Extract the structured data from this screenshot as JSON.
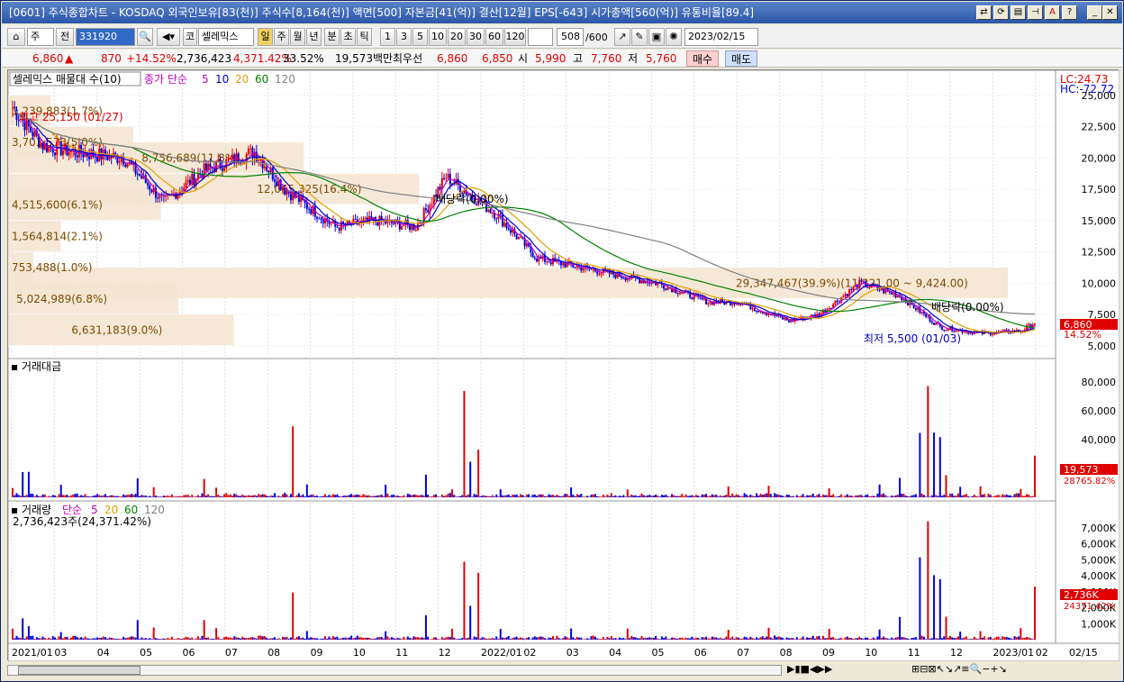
{
  "window": {
    "title": "[0601] 주식종합차트 - KOSDAQ 외국인보유[83(천)] 주식수[8,164(천)] 액면[500] 자본금[41(억)] 결산[12월] EPS[-643] 시가총액[560(억)] 유통비율[89.4]"
  },
  "toolbar": {
    "market": "주",
    "prev_label": "전",
    "code": "331920",
    "code_market": "코",
    "stock_name": "셀레믹스",
    "periods": [
      "일",
      "주",
      "월",
      "년",
      "분",
      "초",
      "틱"
    ],
    "active_period": "일",
    "intervals": [
      "1",
      "3",
      "5",
      "10",
      "20",
      "30",
      "60",
      "120"
    ],
    "count": "508",
    "count_max": "/600",
    "date": "2023/02/15"
  },
  "quote": {
    "price": "6,860",
    "change": "870",
    "change_pct": "+14.52%",
    "volume": "2,736,423",
    "vol_pct": "4,371.42%",
    "turnover": "33.52%",
    "amount": "19,573백만",
    "pref_label": "최우선",
    "ask": "6,860",
    "bid": "6,850",
    "open_label": "시",
    "open": "5,990",
    "high_label": "고",
    "high": "7,760",
    "low_label": "저",
    "low": "5,760",
    "buy_label": "매수",
    "sell_label": "매도"
  },
  "price_pane": {
    "legend_title": "셀레믹스 매물대 수(10)",
    "ma_label": "종가 단순",
    "ma": [
      "5",
      "10",
      "20",
      "60",
      "120"
    ],
    "lc": "LC:24.73",
    "hc": "HC:-72.72",
    "ticks": [
      "25,000",
      "22,500",
      "20,000",
      "17,500",
      "15,000",
      "12,500",
      "10,000",
      "7,500",
      "5,000"
    ],
    "last_price_tag": "6,860",
    "last_pct": "14.52%",
    "high_note": "최고 25,150 (01/27)",
    "low_note": "최저 5,500 (01/03)",
    "dividend_1": "배당락(0.00%)",
    "dividend_2": "배당락(0.00%)",
    "profile": [
      {
        "label": "1,239,883(1.7%)",
        "level": 23750
      },
      {
        "label": "3,703,573(5.0%)",
        "level": 21250
      },
      {
        "label": "4,515,600(6.1%)",
        "level": 16250
      },
      {
        "label": "1,564,814(2.1%)",
        "level": 13750
      },
      {
        "label": "753,488(1.0%)",
        "level": 11250
      },
      {
        "label": "5,024,989(6.8%)",
        "level": 8750
      },
      {
        "label": "6,631,183(9.0%)",
        "level": 6250
      },
      {
        "label": "8,756,689(11.8%)",
        "level": 20000
      },
      {
        "label": "12,065,325(16.4%)",
        "level": 17500
      },
      {
        "label": "29,347,467(39.9%)(11,321.00 ~ 9,424.00)",
        "level": 10000
      }
    ]
  },
  "amount_pane": {
    "title": "거래대금",
    "ticks": [
      "80,000",
      "60,000",
      "40,000",
      "20,000"
    ],
    "last_tag": "19,573",
    "avg_tag": "28765.82%"
  },
  "volume_pane": {
    "title": "거래량",
    "ma_label": "단순",
    "ma": [
      "5",
      "20",
      "60",
      "120"
    ],
    "last_info": "2,736,423주(24,371.42%)",
    "ticks": [
      "7,000K",
      "6,000K",
      "5,000K",
      "4,000K",
      "3,000K",
      "2,000K",
      "1,000K"
    ],
    "last_tag": "2,736K",
    "pct_tag": "24371.42%"
  },
  "x_axis": {
    "labels": [
      "2021/01",
      "03",
      "04",
      "05",
      "06",
      "07",
      "08",
      "09",
      "10",
      "11",
      "12",
      "2022/01",
      "02",
      "03",
      "04",
      "05",
      "06",
      "07",
      "08",
      "09",
      "10",
      "11",
      "12",
      "2023/01",
      "02"
    ],
    "end_label": "02/15"
  },
  "colors": {
    "up": "#e00000",
    "down": "#0000e0",
    "ma5": "#c000c0",
    "ma10": "#0000c0",
    "ma20": "#e0a000",
    "ma60": "#008000",
    "ma120": "#808080",
    "profile": "#f5e6d3"
  },
  "chart_data": {
    "type": "candlestick",
    "x": "2021/01 ~ 2023/02/15",
    "close_last": 6860,
    "high_all": 25150,
    "low_all": 5500,
    "price_range": [
      5000,
      26000
    ],
    "amount_range": [
      0,
      90000
    ],
    "volume_range": [
      0,
      8000
    ]
  }
}
